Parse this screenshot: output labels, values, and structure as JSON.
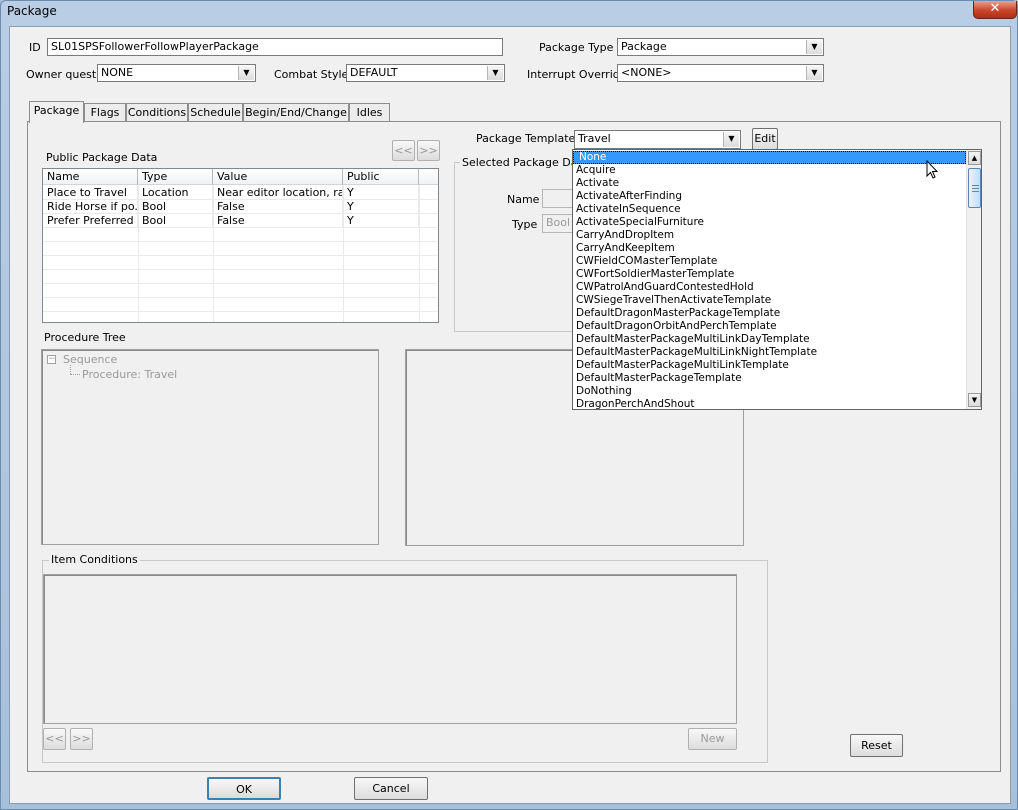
{
  "window": {
    "title": "Package",
    "close_glyph": "✕"
  },
  "form": {
    "id_label": "ID",
    "id_value": "SL01SPSFollowerFollowPlayerPackage",
    "package_type_label": "Package Type",
    "package_type_value": "Package",
    "owner_quest_label": "Owner quest",
    "owner_quest_value": "NONE",
    "combat_style_label": "Combat Style",
    "combat_style_value": "DEFAULT",
    "interrupt_override_label": "Interrupt Override",
    "interrupt_override_value": "<NONE>"
  },
  "tabs": [
    {
      "label": "Package"
    },
    {
      "label": "Flags"
    },
    {
      "label": "Conditions"
    },
    {
      "label": "Schedule"
    },
    {
      "label": "Begin/End/Change"
    },
    {
      "label": "Idles"
    }
  ],
  "package_tab": {
    "public_data_label": "Public Package Data",
    "nav_prev": "<<",
    "nav_next": ">>",
    "columns": [
      "Name",
      "Type",
      "Value",
      "Public"
    ],
    "rows": [
      [
        "Place to Travel",
        "Location",
        "Near editor location, ra...",
        "Y"
      ],
      [
        "Ride Horse if po...",
        "Bool",
        "False",
        "Y"
      ],
      [
        "Prefer Preferred ...",
        "Bool",
        "False",
        "Y"
      ]
    ],
    "package_template_label": "Package Template",
    "package_template_value": "Travel",
    "edit_button": "Edit",
    "selected_data_label": "Selected Package Data",
    "name_label": "Name",
    "type_label": "Type",
    "type_value": "Bool",
    "procedure_tree_label": "Procedure Tree",
    "tree_root": "Sequence",
    "tree_child": "Procedure: Travel",
    "item_conditions_label": "Item Conditions",
    "conditions_prev": "<<",
    "conditions_next": ">>",
    "new_button": "New",
    "reset_button": "Reset"
  },
  "template_dropdown": {
    "items": [
      "None",
      "Acquire",
      "Activate",
      "ActivateAfterFinding",
      "ActivateInSequence",
      "ActivateSpecialFurniture",
      "CarryAndDropItem",
      "CarryAndKeepItem",
      "CWFieldCOMasterTemplate",
      "CWFortSoldierMasterTemplate",
      "CWPatrolAndGuardContestedHold",
      "CWSiegeTravelThenActivateTemplate",
      "DefaultDragonMasterPackageTemplate",
      "DefaultDragonOrbitAndPerchTemplate",
      "DefaultMasterPackageMultiLinkDayTemplate",
      "DefaultMasterPackageMultiLinkNightTemplate",
      "DefaultMasterPackageMultiLinkTemplate",
      "DefaultMasterPackageTemplate",
      "DoNothing",
      "DragonPerchAndShout"
    ],
    "selected_index": 0
  },
  "footer": {
    "ok_button": "OK",
    "cancel_button": "Cancel"
  },
  "icons": {
    "combo_arrow": "▼",
    "scroll_up": "▲",
    "scroll_down": "▼",
    "tree_collapse": "−"
  },
  "colors": {
    "selection": "#3399ff",
    "titlebar": "#b9cde4",
    "close": "#c7472d"
  }
}
